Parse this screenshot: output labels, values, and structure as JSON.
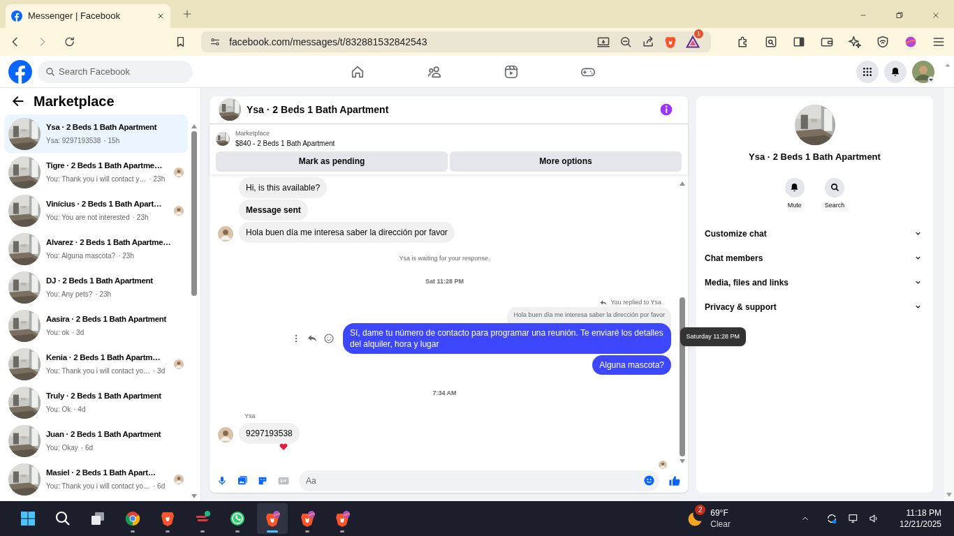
{
  "browser": {
    "tab_title": "Messenger | Facebook",
    "address": "facebook.com/messages/t/832881532842543",
    "extension_badge": "1"
  },
  "header": {
    "search_placeholder": "Search Facebook"
  },
  "sidebar": {
    "title": "Marketplace",
    "conversations": [
      {
        "name": "Ysa · 2 Beds 1 Bath Apartment",
        "preview": "Ysa: 9297193538",
        "time": "· 15h",
        "selected": true,
        "seen": false
      },
      {
        "name": "Tigre · 2 Beds 1 Bath Apartme…",
        "preview": "You: Thank you i will contact y…",
        "time": "· 23h",
        "selected": false,
        "seen": true
      },
      {
        "name": "Vinícius · 2 Beds 1 Bath Apart…",
        "preview": "You: You are not interested",
        "time": "· 23h",
        "selected": false,
        "seen": true
      },
      {
        "name": "Alvarez · 2 Beds 1 Bath Apartme…",
        "preview": "You: Alguna mascota?",
        "time": "· 23h",
        "selected": false,
        "seen": false
      },
      {
        "name": "DJ · 2 Beds 1 Bath Apartment",
        "preview": "You: Any pets?",
        "time": "· 23h",
        "selected": false,
        "seen": false
      },
      {
        "name": "Aasira · 2 Beds 1 Bath Apartment",
        "preview": "You: ok",
        "time": "· 3d",
        "selected": false,
        "seen": false
      },
      {
        "name": "Kenia · 2 Beds 1 Bath Apartm…",
        "preview": "You: Thank you i will contact yo…",
        "time": "· 3d",
        "selected": false,
        "seen": true
      },
      {
        "name": "Truly · 2 Beds 1 Bath Apartment",
        "preview": "You: Ok",
        "time": "· 4d",
        "selected": false,
        "seen": false
      },
      {
        "name": "Juan · 2 Beds 1 Bath Apartment",
        "preview": "You: Okay",
        "time": "· 6d",
        "selected": false,
        "seen": false
      },
      {
        "name": "Masiel · 2 Beds 1 Bath Apart…",
        "preview": "You: Thank you i will contact yo…",
        "time": "· 6d",
        "selected": false,
        "seen": true
      }
    ]
  },
  "chat": {
    "title": "Ysa · 2 Beds 1 Bath Apartment",
    "listing": {
      "label": "Marketplace",
      "title": "$840 - 2 Beds 1 Bath Apartment"
    },
    "actions": [
      "Mark as pending",
      "More options"
    ],
    "messages": [
      {
        "kind": "incoming",
        "text": "Hi, is this available?",
        "avatar": false,
        "bold": false,
        "reaction": false
      },
      {
        "kind": "incoming",
        "text": "Message sent",
        "avatar": false,
        "bold": true,
        "reaction": false
      },
      {
        "kind": "incoming",
        "text": "Hola buen día me interesa saber la dirección por favor",
        "avatar": true,
        "bold": false,
        "reaction": false
      },
      {
        "kind": "notice",
        "text": "Ysa is waiting for your response."
      },
      {
        "kind": "timestamp",
        "text": "Sat 11:28 PM"
      },
      {
        "kind": "reply_note",
        "text": "You replied to Ysa"
      },
      {
        "kind": "quote",
        "text": "Hola buen día me interesa saber la dirección por favor"
      },
      {
        "kind": "outgoing",
        "text": "Sí, dame tu número de contacto para programar una reunión. Te enviaré los detalles del alquiler, hora y lugar",
        "tooltip": "Saturday 11:28 PM"
      },
      {
        "kind": "outgoing",
        "text": "Alguna mascota?"
      },
      {
        "kind": "timestamp",
        "text": "7:34 AM"
      },
      {
        "kind": "sender",
        "text": "Ysa"
      },
      {
        "kind": "incoming",
        "text": "9297193538",
        "avatar": true,
        "bold": false,
        "reaction": true
      },
      {
        "kind": "seen"
      }
    ],
    "composer_placeholder": "Aa"
  },
  "details": {
    "name": "Ysa · 2 Beds 1 Bath Apartment",
    "actions": [
      {
        "kind": "bell",
        "label": "Mute"
      },
      {
        "kind": "search",
        "label": "Search"
      }
    ],
    "sections": [
      {
        "label": "Customize chat",
        "expanded": false
      },
      {
        "label": "Chat members",
        "expanded": false
      },
      {
        "label": "Media, files and links",
        "expanded": false
      },
      {
        "label": "Privacy & support",
        "expanded": false
      }
    ]
  },
  "taskbar": {
    "apps": [
      {
        "kind": "start",
        "active": false
      },
      {
        "kind": "search",
        "active": false
      },
      {
        "kind": "taskview",
        "active": false
      },
      {
        "kind": "chrome",
        "active": false
      },
      {
        "kind": "brave",
        "active": false
      },
      {
        "kind": "express",
        "active": false
      },
      {
        "kind": "whatsapp",
        "active": false
      },
      {
        "kind": "brave_profile",
        "active": true
      },
      {
        "kind": "brave_profile",
        "active": false
      },
      {
        "kind": "brave_profile",
        "active": false
      }
    ],
    "weather": {
      "badge": "2",
      "temperature": "69°F",
      "condition": "Clear"
    },
    "time": "11:18 PM",
    "date": "12/21/2025"
  }
}
